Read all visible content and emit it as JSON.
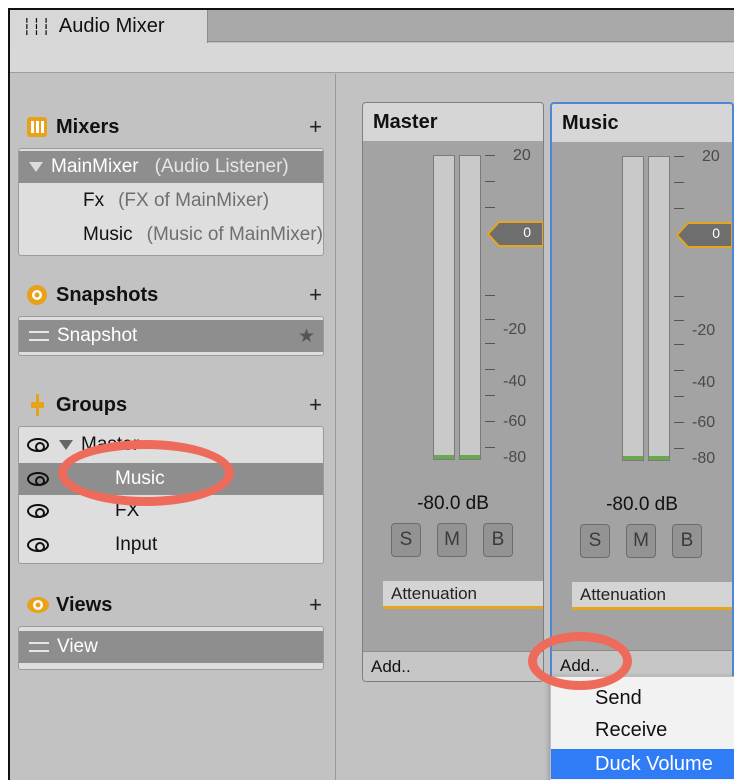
{
  "window": {
    "tab_title": "Audio Mixer",
    "tab_icon": "mixer-sliders-icon"
  },
  "sidebar": {
    "mixers": {
      "title": "Mixers",
      "add": "+",
      "items": [
        {
          "name": "MainMixer",
          "detail": "(Audio Listener)"
        },
        {
          "name": "Fx",
          "detail": "(FX of MainMixer)"
        },
        {
          "name": "Music",
          "detail": "(Music of MainMixer)"
        }
      ]
    },
    "snapshots": {
      "title": "Snapshots",
      "add": "+",
      "items": [
        {
          "name": "Snapshot",
          "star": "★"
        }
      ]
    },
    "groups": {
      "title": "Groups",
      "add": "+",
      "items": [
        {
          "name": "Master"
        },
        {
          "name": "Music"
        },
        {
          "name": "FX"
        },
        {
          "name": "Input"
        }
      ]
    },
    "views": {
      "title": "Views",
      "add": "+",
      "items": [
        {
          "name": "View"
        }
      ]
    }
  },
  "strips": [
    {
      "name": "Master",
      "fader_value": "0",
      "db_readout": "-80.0 dB",
      "buttons": [
        "S",
        "M",
        "B"
      ],
      "effect": "Attenuation",
      "add_label": "Add..",
      "scale": [
        "20",
        "-20",
        "-40",
        "-60",
        "-80"
      ]
    },
    {
      "name": "Music",
      "fader_value": "0",
      "db_readout": "-80.0 dB",
      "buttons": [
        "S",
        "M",
        "B"
      ],
      "effect": "Attenuation",
      "add_label": "Add..",
      "scale": [
        "20",
        "-20",
        "-40",
        "-60",
        "-80"
      ]
    }
  ],
  "dropdown": {
    "items": [
      "Send",
      "Receive",
      "Duck Volume"
    ],
    "highlighted": "Duck Volume"
  },
  "colors": {
    "selection_blue": "#2f7cf6",
    "annotation_red": "#ee6b5b",
    "effect_underline": "#e3a61d",
    "selected_strip_border": "#4f87d8"
  }
}
